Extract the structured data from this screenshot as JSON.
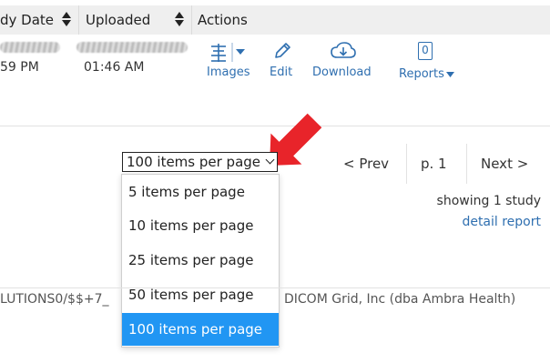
{
  "table": {
    "headers": [
      {
        "label": "dy Date"
      },
      {
        "label": "Uploaded"
      },
      {
        "label": "Actions"
      }
    ],
    "row": {
      "study_time": "59 PM",
      "uploaded_time": "01:46 AM"
    }
  },
  "actions": {
    "images": "Images",
    "edit": "Edit",
    "download": "Download",
    "reports": "Reports",
    "reports_count": "0"
  },
  "pagination": {
    "select_value": "100 items per page",
    "options": [
      "5 items per page",
      "10 items per page",
      "25 items per page",
      "50 items per page",
      "100 items per page"
    ],
    "selected_index": 4,
    "prev": "< Prev",
    "page": "p. 1",
    "next": "Next >"
  },
  "summary": {
    "showing": "showing 1 study",
    "detail_link": "detail report"
  },
  "footer": {
    "left": "LUTIONS0/$$+7_",
    "right": "DICOM Grid, Inc (dba Ambra Health)"
  },
  "colors": {
    "accent_blue": "#2f6fb0",
    "selected_option": "#2196f3",
    "arrow_red": "#e8242a"
  }
}
